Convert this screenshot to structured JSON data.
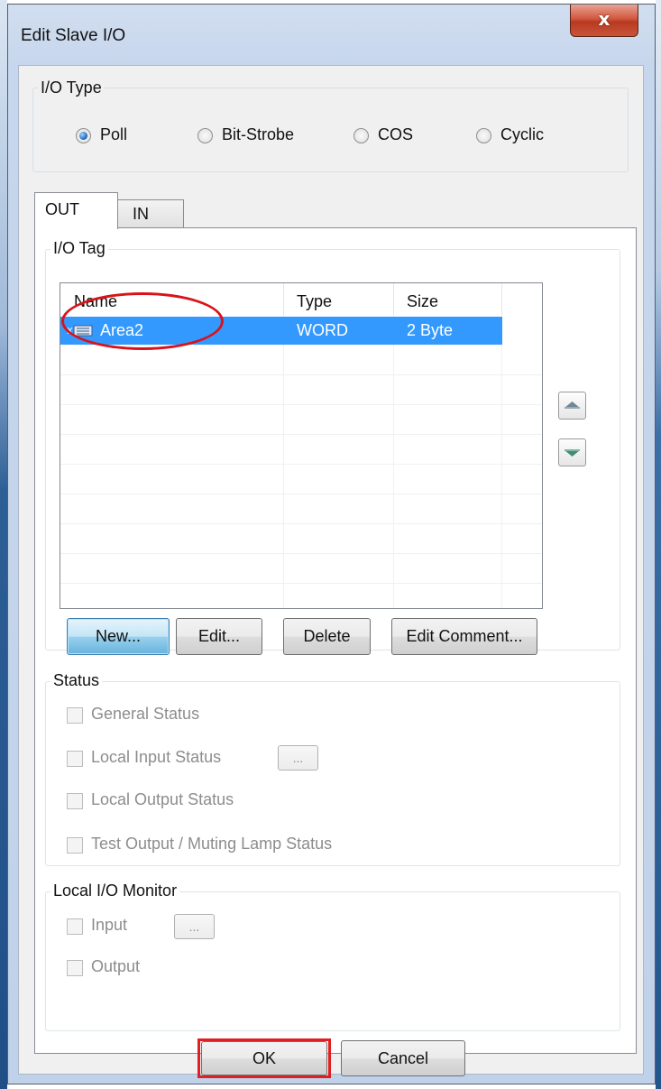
{
  "window": {
    "title": "Edit Slave I/O",
    "close_label": "x"
  },
  "io_type": {
    "legend": "I/O Type",
    "options": [
      {
        "label": "Poll",
        "selected": true
      },
      {
        "label": "Bit-Strobe",
        "selected": false
      },
      {
        "label": "COS",
        "selected": false
      },
      {
        "label": "Cyclic",
        "selected": false
      }
    ]
  },
  "tabs": [
    {
      "label": "OUT",
      "active": true
    },
    {
      "label": "IN",
      "active": false
    }
  ],
  "io_tag": {
    "legend": "I/O Tag",
    "columns": [
      "Name",
      "Type",
      "Size"
    ],
    "rows": [
      {
        "name": "Area2",
        "type": "WORD",
        "size": "2 Byte",
        "selected": true
      }
    ],
    "buttons": {
      "new": "New...",
      "edit": "Edit...",
      "delete": "Delete",
      "edit_comment": "Edit Comment..."
    },
    "move_up_icon": "move-up-icon",
    "move_down_icon": "move-down-icon"
  },
  "status": {
    "legend": "Status",
    "items": [
      {
        "label": "General Status",
        "checked": false
      },
      {
        "label": "Local Input Status",
        "checked": false,
        "browse": "..."
      },
      {
        "label": "Local Output Status",
        "checked": false
      },
      {
        "label": "Test Output / Muting Lamp Status",
        "checked": false
      }
    ]
  },
  "local_io_monitor": {
    "legend": "Local I/O Monitor",
    "items": [
      {
        "label": "Input",
        "checked": false,
        "browse": "..."
      },
      {
        "label": "Output",
        "checked": false
      }
    ]
  },
  "footer": {
    "ok": "OK",
    "cancel": "Cancel"
  },
  "colors": {
    "selection": "#3399ff",
    "annotation_red": "#d8141a",
    "close_button": "#c9543a"
  }
}
